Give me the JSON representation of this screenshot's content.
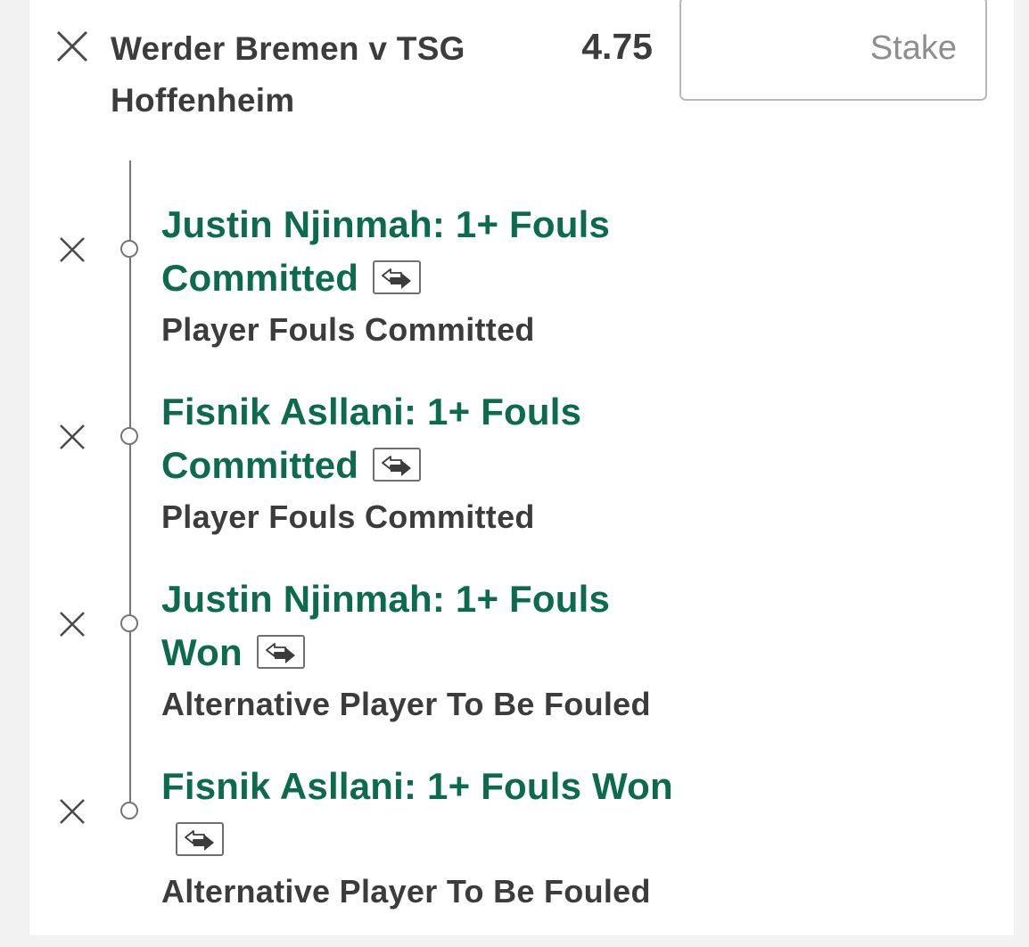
{
  "header": {
    "match": "Werder Bremen v TSG Hoffenheim",
    "odds": "4.75",
    "stake_placeholder": "Stake"
  },
  "legs": [
    {
      "selection": "Justin Njinmah: 1+ Fouls Committed",
      "market": "Player Fouls Committed"
    },
    {
      "selection": "Fisnik Asllani: 1+ Fouls Committed",
      "market": "Player Fouls Committed"
    },
    {
      "selection": "Justin Njinmah: 1+ Fouls Won",
      "market": "Alternative Player To Be Fouled"
    },
    {
      "selection": "Fisnik Asllani: 1+ Fouls Won",
      "market": "Alternative Player To Be Fouled"
    }
  ],
  "colors": {
    "selection_green": "#0c6b4a",
    "text_dark": "#3c3c3c",
    "timeline_grey": "#767676",
    "page_background": "#f2f2f2"
  },
  "icons": {
    "remove": "close-icon",
    "bet_builder_swap": "swap-arrows-icon"
  }
}
